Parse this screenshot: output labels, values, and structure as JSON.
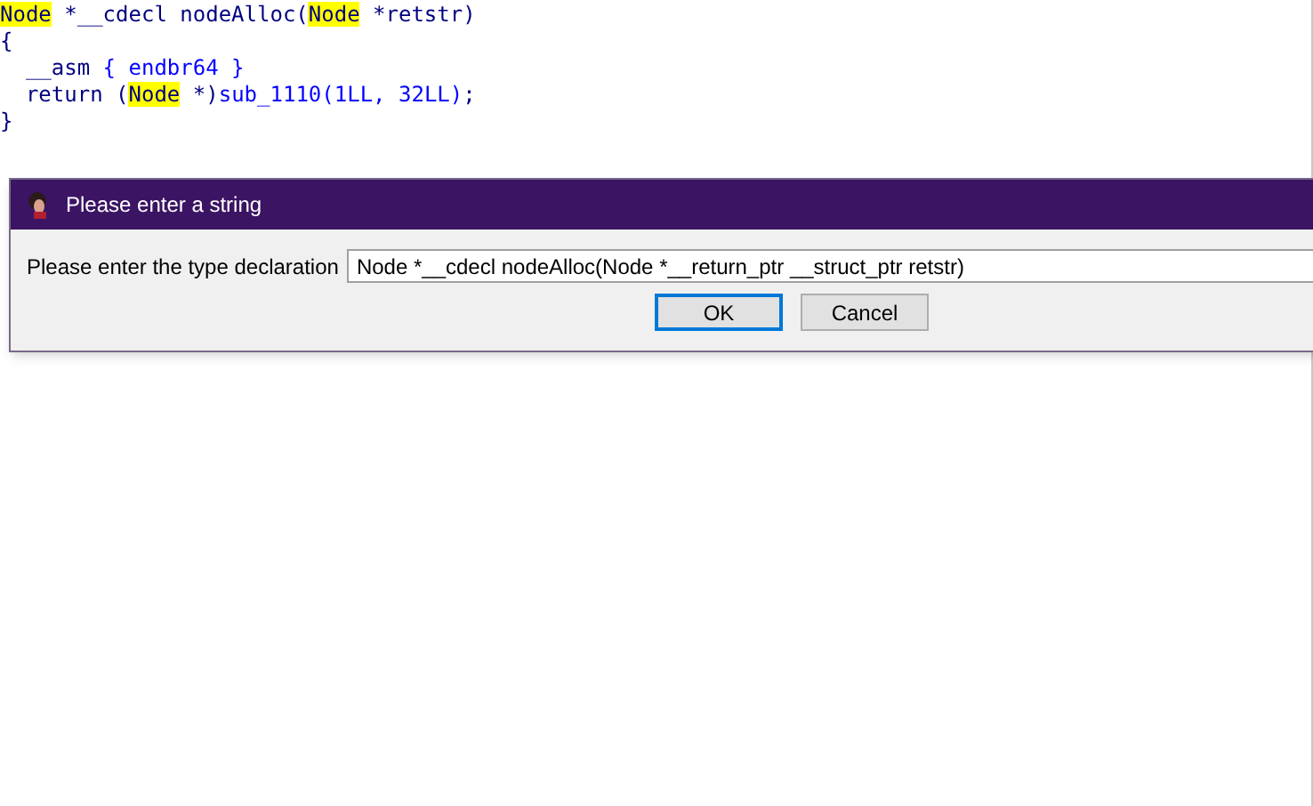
{
  "code_lines": [
    [
      {
        "kind": "highlight",
        "text": "Node"
      },
      {
        "kind": "plain",
        "text": " *__cdecl nodeAlloc("
      },
      {
        "kind": "highlight",
        "text": "Node"
      },
      {
        "kind": "plain",
        "text": " *retstr)"
      }
    ],
    [
      {
        "kind": "plain",
        "text": "{"
      }
    ],
    [
      {
        "kind": "plain",
        "text": "  __asm "
      },
      {
        "kind": "blue",
        "text": "{ endbr64 }"
      }
    ],
    [
      {
        "kind": "plain",
        "text": "  return ("
      },
      {
        "kind": "highlight",
        "text": "Node"
      },
      {
        "kind": "plain",
        "text": " *)"
      },
      {
        "kind": "blue",
        "text": "sub_1110(1LL, 32LL)"
      },
      {
        "kind": "plain",
        "text": ";"
      }
    ],
    [
      {
        "kind": "plain",
        "text": "}"
      }
    ]
  ],
  "dialog": {
    "title": "Please enter a string",
    "label": "Please enter the type declaration",
    "value": "Node *__cdecl nodeAlloc(Node *__return_ptr __struct_ptr retstr)",
    "buttons": [
      {
        "label": "OK",
        "selected": true
      },
      {
        "label": "Cancel",
        "selected": false
      }
    ]
  }
}
